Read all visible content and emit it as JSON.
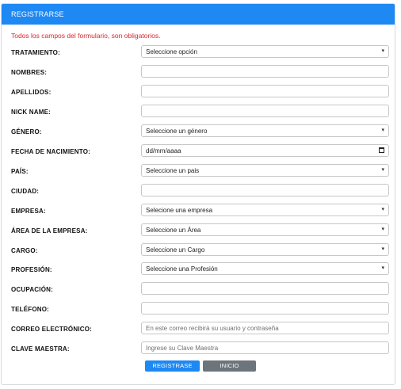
{
  "header": {
    "title": "REGISTRARSE"
  },
  "notice": "Todos los campos del formulario, son obligatorios.",
  "form": {
    "tratamiento": {
      "label": "TRATAMIENTO:",
      "value": "Seleccione opción"
    },
    "nombres": {
      "label": "NOMBRES:",
      "value": ""
    },
    "apellidos": {
      "label": "APELLIDOS:",
      "value": ""
    },
    "nick": {
      "label": "NICK NAME:",
      "value": ""
    },
    "genero": {
      "label": "GÉNERO:",
      "value": "Seleccione un género"
    },
    "fecha": {
      "label": "FECHA DE NACIMIENTO:",
      "value": "dd/mm/aaaa"
    },
    "pais": {
      "label": "PAÍS:",
      "value": "Seleccione un pais"
    },
    "ciudad": {
      "label": "CIUDAD:",
      "value": ""
    },
    "empresa": {
      "label": "EMPRESA:",
      "value": "Selecione una empresa"
    },
    "area": {
      "label": "ÁREA DE LA EMPRESA:",
      "value": "Seleccione un Área"
    },
    "cargo": {
      "label": "CARGO:",
      "value": "Seleccione un Cargo"
    },
    "profesion": {
      "label": "PROFESIÓN:",
      "value": "Seleccione una Profesión"
    },
    "ocupacion": {
      "label": "OCUPACIÓN:",
      "value": ""
    },
    "telefono": {
      "label": "TELÉFONO:",
      "value": ""
    },
    "correo": {
      "label": "CORREO ELECTRÓNICO:",
      "placeholder": "En este correo recibirá su usuario y contraseña"
    },
    "clave": {
      "label": "CLAVE MAESTRA:",
      "placeholder": "Ingrese su Clave Maestra"
    }
  },
  "buttons": {
    "submit": "REGISTRASE",
    "home": "INICIO"
  },
  "colors": {
    "primary": "#1e88f3",
    "secondary": "#6c747c",
    "notice": "#d9262c"
  },
  "icons": {
    "select": "chevron-down-icon",
    "date": "calendar-icon"
  }
}
